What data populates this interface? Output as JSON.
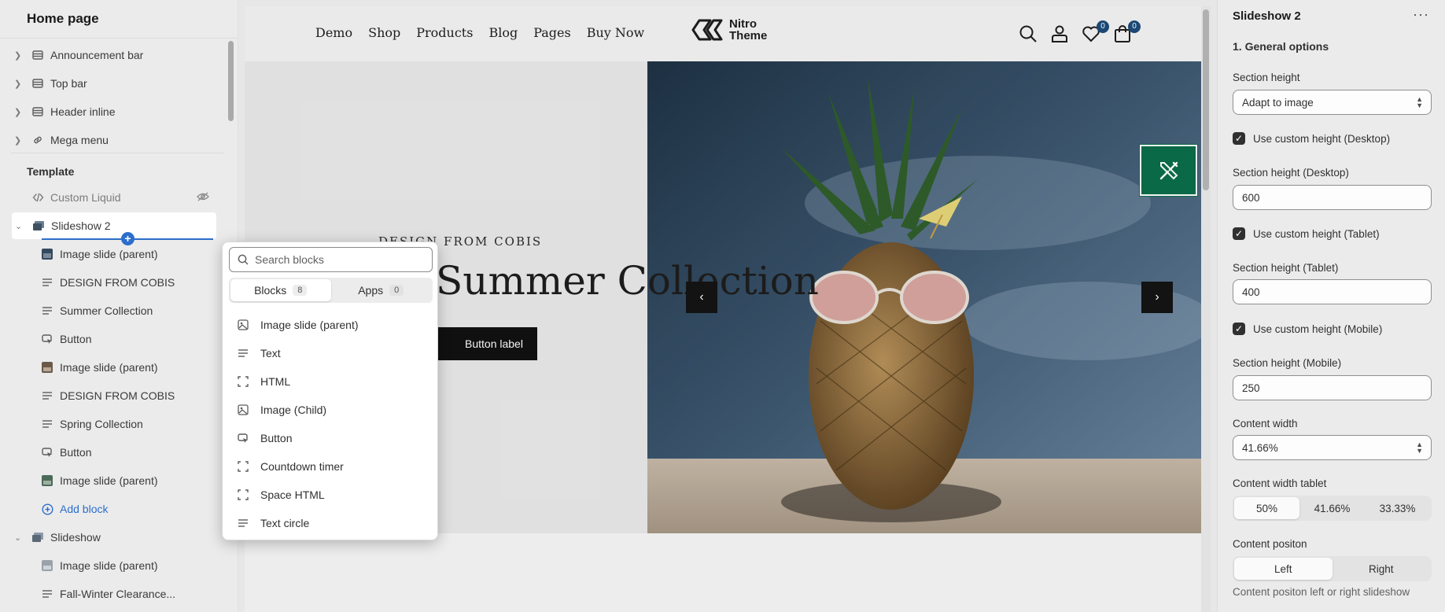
{
  "sidebar": {
    "title": "Home page",
    "header_items": [
      {
        "label": "Announcement bar",
        "icon": "section-icon"
      },
      {
        "label": "Top bar",
        "icon": "section-icon"
      },
      {
        "label": "Header inline",
        "icon": "section-icon"
      },
      {
        "label": "Mega menu",
        "icon": "link-icon"
      }
    ],
    "template_label": "Template",
    "template_items": [
      {
        "label": "Custom Liquid",
        "icon": "code-icon"
      },
      {
        "label": "Slideshow 2",
        "icon": "slideshow-icon"
      },
      {
        "label": "Image slide (parent)",
        "icon": "image-thumb-icon"
      },
      {
        "label": "DESIGN FROM COBIS",
        "icon": "text-icon"
      },
      {
        "label": "Summer Collection",
        "icon": "text-icon"
      },
      {
        "label": "Button",
        "icon": "button-icon"
      },
      {
        "label": "Image slide (parent)",
        "icon": "image-thumb-icon"
      },
      {
        "label": "DESIGN FROM COBIS",
        "icon": "text-icon"
      },
      {
        "label": "Spring Collection",
        "icon": "text-icon"
      },
      {
        "label": "Button",
        "icon": "button-icon"
      },
      {
        "label": "Image slide (parent)",
        "icon": "image-thumb-icon"
      },
      {
        "label": "Add block",
        "icon": "plus-circle-icon"
      },
      {
        "label": "Slideshow",
        "icon": "slideshow-icon"
      },
      {
        "label": "Image slide (parent)",
        "icon": "image-thumb-icon"
      },
      {
        "label": "Fall-Winter Clearance...",
        "icon": "text-icon"
      }
    ]
  },
  "preview": {
    "nav_links": [
      "Demo",
      "Shop",
      "Products",
      "Blog",
      "Pages",
      "Buy Now"
    ],
    "logo_text_1": "Nitro",
    "logo_text_2": "Theme",
    "wishlist_count": "0",
    "cart_count": "0",
    "hero": {
      "kicker": "DESIGN FROM COBIS",
      "headline": "Summer Collection",
      "button_label": "Button label",
      "prev": "‹",
      "next": "›"
    }
  },
  "picker": {
    "search_placeholder": "Search blocks",
    "tabs": [
      {
        "label": "Blocks",
        "count": "8"
      },
      {
        "label": "Apps",
        "count": "0"
      }
    ],
    "items": [
      {
        "label": "Image slide (parent)",
        "icon": "image-icon"
      },
      {
        "label": "Text",
        "icon": "text-icon"
      },
      {
        "label": "HTML",
        "icon": "frame-icon"
      },
      {
        "label": "Image (Child)",
        "icon": "image-icon"
      },
      {
        "label": "Button",
        "icon": "button-icon"
      },
      {
        "label": "Countdown timer",
        "icon": "frame-icon"
      },
      {
        "label": "Space HTML",
        "icon": "frame-icon"
      },
      {
        "label": "Text circle",
        "icon": "text-icon"
      }
    ]
  },
  "settings": {
    "title": "Slideshow 2",
    "more": "···",
    "section": "1. General options",
    "section_height_label": "Section height",
    "section_height_value": "Adapt to image",
    "chk_desktop": "Use custom height (Desktop)",
    "height_desktop_label": "Section height (Desktop)",
    "height_desktop_value": "600",
    "chk_tablet": "Use custom height (Tablet)",
    "height_tablet_label": "Section height (Tablet)",
    "height_tablet_value": "400",
    "chk_mobile": "Use custom height (Mobile)",
    "height_mobile_label": "Section height (Mobile)",
    "height_mobile_value": "250",
    "content_width_label": "Content width",
    "content_width_value": "41.66%",
    "content_width_tablet_label": "Content width tablet",
    "content_width_tablet_options": [
      "50%",
      "41.66%",
      "33.33%"
    ],
    "content_position_label": "Content positon",
    "content_position_options": [
      "Left",
      "Right"
    ],
    "content_position_hint": "Content positon left or right slideshow"
  },
  "colors": {
    "accent_blue": "#2c6ecb",
    "tool_green": "#0b6e4a",
    "badge_blue": "#1d4b7a"
  }
}
